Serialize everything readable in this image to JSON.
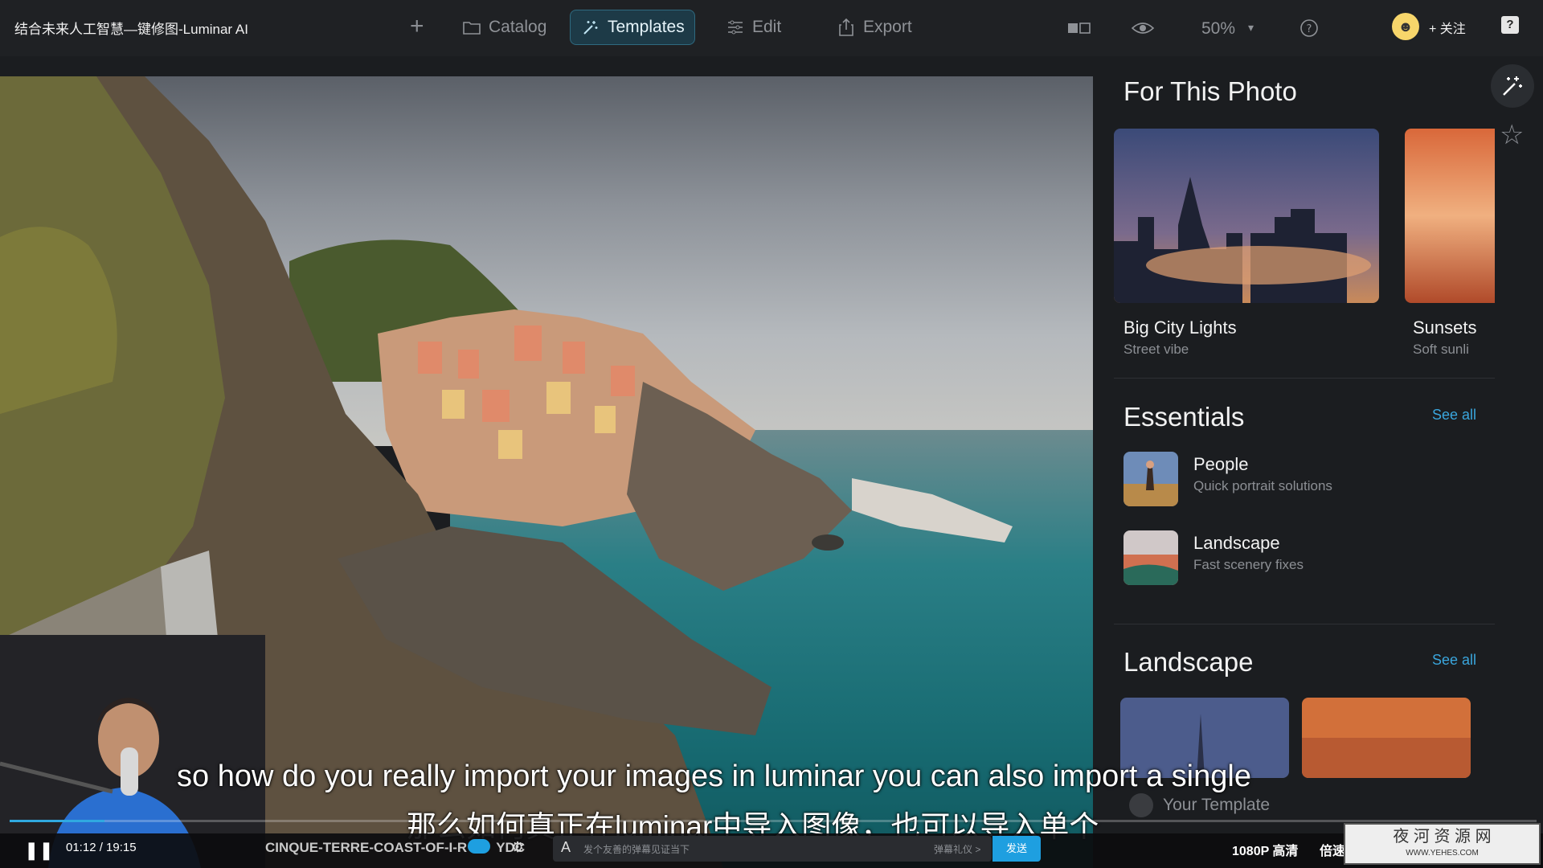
{
  "window": {
    "title": "结合未来人工智慧—键修图-Luminar AI"
  },
  "nav": {
    "catalog": "Catalog",
    "templates": "Templates",
    "edit": "Edit",
    "export": "Export",
    "zoom": "50%",
    "follow": "+ 关注"
  },
  "panel": {
    "for_this_photo": "For This Photo",
    "featured": [
      {
        "title": "Big City Lights",
        "subtitle": "Street vibe"
      },
      {
        "title": "Sunsets",
        "subtitle": "Soft sunli"
      }
    ],
    "essentials": {
      "heading": "Essentials",
      "see_all": "See all",
      "items": [
        {
          "title": "People",
          "subtitle": "Quick portrait solutions"
        },
        {
          "title": "Landscape",
          "subtitle": "Fast scenery fixes"
        }
      ]
    },
    "landscape": {
      "heading": "Landscape",
      "see_all": "See all"
    },
    "your_template": "Your Template"
  },
  "video": {
    "subtitle_en": "so how do you really import your images in luminar you can also import a single",
    "subtitle_zh": "那么如何真正在luminar中导入图像，也可以导入单个",
    "time": "01:12 / 19:15",
    "progress": 0.062,
    "filename": "CINQUE-TERRE-COAST-OF-I-R",
    "filename_tail": "YDC",
    "danmu_placeholder": "发个友善的弹幕见证当下",
    "danmu_gift": "弹幕礼仪 >",
    "send": "发送",
    "quality": "1080P 高清",
    "speed": "倍速",
    "watermark": "夜 河 资 源 网",
    "watermark_url": "WWW.YEHES.COM"
  },
  "colors": {
    "accent": "#30a9e0",
    "active_tab_bg": "#1d3a47",
    "link": "#3aa6dd"
  }
}
